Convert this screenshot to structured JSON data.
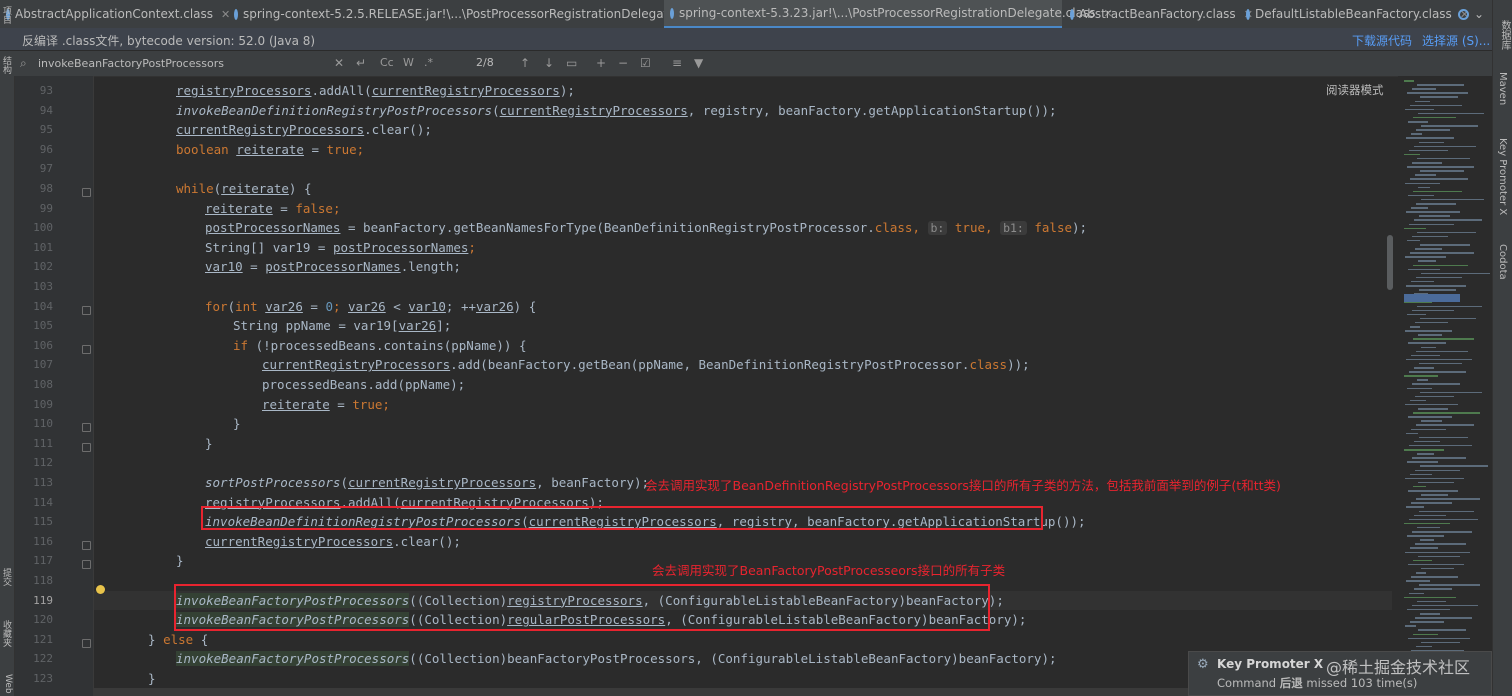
{
  "tabs": [
    {
      "label": "AbstractApplicationContext.class",
      "active": false
    },
    {
      "label": "spring-context-5.2.5.RELEASE.jar!\\...\\PostProcessorRegistrationDelegate.class",
      "active": false
    },
    {
      "label": "spring-context-5.3.23.jar!\\...\\PostProcessorRegistrationDelegate.class",
      "active": true
    },
    {
      "label": "AbstractBeanFactory.class",
      "active": false
    },
    {
      "label": "DefaultListableBeanFactory.class",
      "active": false
    }
  ],
  "tab_close": "✕",
  "tab_more": "⌄",
  "infobar": {
    "text": "反编译 .class文件, bytecode version: 52.0 (Java 8)",
    "download_link": "下载源代码",
    "choose_link": "选择源 (S)..."
  },
  "search": {
    "value": "invokeBeanFactoryPostProcessors",
    "match_count": "2/8"
  },
  "reader_mode": "阅读器模式",
  "left_stripe": {
    "top_label": "项目",
    "mid_label": "结构",
    "bottom_label1": "提交",
    "bottom_label2": "收藏夹",
    "bottom_label3": "Web"
  },
  "right_stripe": [
    "数据库",
    "Maven",
    "Key Promoter X",
    "Codota"
  ],
  "line_numbers": [
    "93",
    "94",
    "95",
    "96",
    "97",
    "98",
    "99",
    "100",
    "101",
    "102",
    "103",
    "104",
    "105",
    "106",
    "107",
    "108",
    "109",
    "110",
    "111",
    "112",
    "113",
    "114",
    "115",
    "116",
    "117",
    "118",
    "119",
    "120",
    "121",
    "122",
    "123"
  ],
  "code": {
    "l93_a": "registryProcessors",
    "l93_b": ".addAll(",
    "l93_c": "currentRegistryProcessors",
    "l93_d": ");",
    "l94_a": "invokeBeanDefinitionRegistryPostProcessors",
    "l94_b": "(",
    "l94_c": "currentRegistryProcessors",
    "l94_d": ", registry, beanFactory.getApplicationStartup());",
    "l95_a": "currentRegistryProcessors",
    "l95_b": ".clear();",
    "l96_kw": "boolean",
    "l96_a": "reiterate",
    "l96_b": " = ",
    "l96_kw2": "true",
    "l96_c": ";",
    "l98_kw": "while",
    "l98_a": "(",
    "l98_b": "reiterate",
    "l98_c": ") {",
    "l99_a": "reiterate",
    "l99_b": " = ",
    "l99_kw": "false",
    "l99_c": ";",
    "l100_a": "postProcessorNames",
    "l100_b": " = beanFactory.getBeanNamesForType(BeanDefinitionRegistryPostProcessor.",
    "l100_kw": "class",
    "l100_c": ",",
    "l100_h1": "b:",
    "l100_kw2": "true",
    "l100_d": ",",
    "l100_h2": "b1:",
    "l100_kw3": "false",
    "l100_e": ");",
    "l101_a": "String[] var19 = ",
    "l101_b": "postProcessorNames",
    "l101_c": ";",
    "l102_a": "var10",
    "l102_b": " = ",
    "l102_c": "postProcessorNames",
    "l102_d": ".length;",
    "l104_kw": "for",
    "l104_a": "(",
    "l104_kw2": "int",
    "l104_b": "var26",
    "l104_c": " = ",
    "l104_n": "0",
    "l104_d": "; ",
    "l104_e": "var26",
    "l104_f": " < ",
    "l104_g": "var10",
    "l104_h": "; ++",
    "l104_i": "var26",
    "l104_j": ") {",
    "l105_a": "String ppName = var19[",
    "l105_b": "var26",
    "l105_c": "];",
    "l106_kw": "if",
    "l106_a": " (!processedBeans.contains(ppName)) {",
    "l107_a": "currentRegistryProcessors",
    "l107_b": ".add(beanFactory.getBean(ppName, BeanDefinitionRegistryPostProcessor.",
    "l107_kw": "class",
    "l107_c": "));",
    "l108_a": "processedBeans.add(ppName);",
    "l109_a": "reiterate",
    "l109_b": " = ",
    "l109_kw": "true",
    "l109_c": ";",
    "l110_a": "}",
    "l111_a": "}",
    "l113_a": "sortPostProcessors",
    "l113_b": "(",
    "l113_c": "currentRegistryProcessors",
    "l113_d": ", beanFactory);",
    "l114_a": "registryProcessors",
    "l114_b": ".addAll(",
    "l114_c": "currentRegistryProcessors",
    "l114_d": ");",
    "l115_a": "invokeBeanDefinitionRegistryPostProcessors",
    "l115_b": "(",
    "l115_c": "currentRegistryProcessors",
    "l115_d": ", registry, beanFactory.getApplicationStartup());",
    "l116_a": "currentRegistryProcessors",
    "l116_b": ".clear();",
    "l117_a": "}",
    "l119_a": "invokeBeanFactoryPostProcessors",
    "l119_b": "((Collection)",
    "l119_c": "registryProcessors",
    "l119_d": ", (ConfigurableListableBeanFactory)beanFactory);",
    "l120_a": "invokeBeanFactoryPostProcessors",
    "l120_b": "((Collection)",
    "l120_c": "regularPostProcessors",
    "l120_d": ", (ConfigurableListableBeanFactory)beanFactory);",
    "l121_a": "} ",
    "l121_kw": "else",
    "l121_b": " {",
    "l122_a": "invokeBeanFactoryPostProcessors",
    "l122_b": "((Collection)beanFactoryPostProcessors, (ConfigurableListableBeanFactory)beanFactory);",
    "l123_a": "}"
  },
  "annotations": {
    "a1": "会去调用实现了BeanDefinitionRegistryPostProcessors接口的所有子类的方法，包括我前面举到的例子(t和tt类)",
    "a2": "会去调用实现了BeanFactoryPostProcesseors接口的所有子类"
  },
  "toast": {
    "title": "Key Promoter X",
    "prefix": "Command ",
    "command": "后退",
    "suffix": " missed 103 time(s)"
  },
  "watermark": "@稀土掘金技术社区"
}
